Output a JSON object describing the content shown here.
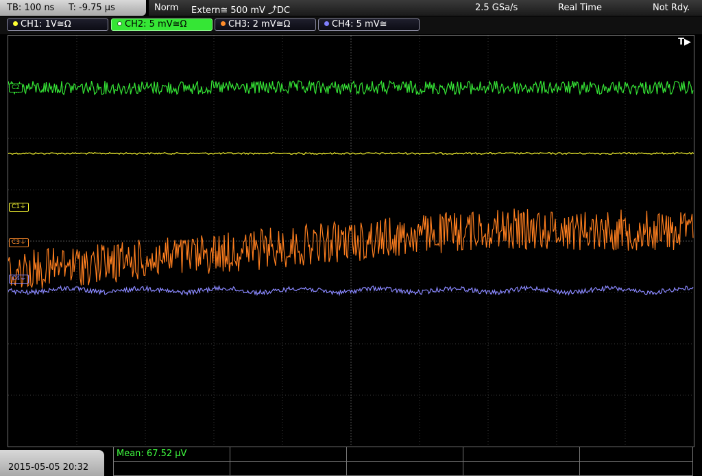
{
  "status": {
    "timebase": "TB: 100 ns",
    "trigger_time": "T: -9.75 µs",
    "mode": "Norm",
    "source": "Extern≅ 500 mV ⤴DC",
    "sample_rate": "2.5 GSa/s",
    "acq_mode": "Real Time",
    "state": "Not Rdy."
  },
  "channels": [
    {
      "label": "CH1: 1V≅Ω",
      "color": "#ffff33",
      "active": false
    },
    {
      "label": "CH2: 5 mV≅Ω",
      "color": "#35e635",
      "active": true
    },
    {
      "label": "CH3: 2 mV≅Ω",
      "color": "#ff8c2a",
      "active": false
    },
    {
      "label": "CH4: 5 mV≅",
      "color": "#8080ff",
      "active": false
    }
  ],
  "markers": {
    "c1": "C1⏚",
    "c3": "C3⏚",
    "c4": "C4⏚",
    "c2": "C2",
    "trigger": "T▶"
  },
  "footer": {
    "datetime": "2015-05-05 20:32",
    "measurement": "Mean: 67.52 µV"
  },
  "colors": {
    "ch1": "#ffff33",
    "ch2": "#35e635",
    "ch3": "#ff7f1f",
    "ch4": "#8a88ff",
    "grid": "#3c3c3c"
  }
}
